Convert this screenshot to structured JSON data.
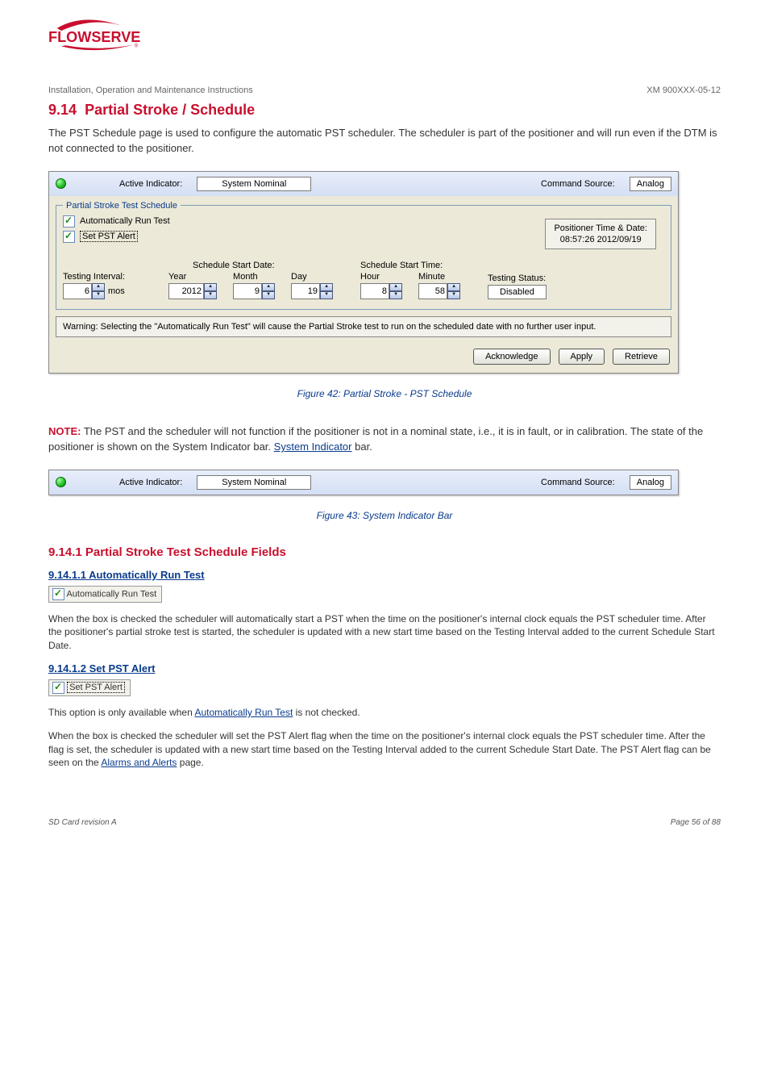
{
  "header": {
    "doc_type": "Installation, Operation and Maintenance Instructions",
    "doc_ref": "XM 900XXX-05-12"
  },
  "section": {
    "number": "9.14",
    "title": "Partial Stroke / Schedule",
    "intro": "The PST Schedule page is used to configure the automatic PST scheduler. The scheduler is part of the positioner and will run even if the DTM is not connected to the positioner.",
    "figure_caption": "Figure 42: Partial Stroke - PST Schedule"
  },
  "ui": {
    "active_indicator_label": "Active Indicator:",
    "active_indicator_value": "System Nominal",
    "command_source_label": "Command Source:",
    "command_source_value": "Analog",
    "group_title": "Partial Stroke Test Schedule",
    "auto_run_label": "Automatically Run Test",
    "set_pst_label": "Set PST Alert",
    "positioner_time_label": "Positioner Time & Date:",
    "positioner_time_value": "08:57:26 2012/09/19",
    "testing_interval_label": "Testing Interval:",
    "testing_interval_value": "6",
    "testing_interval_unit": "mos",
    "schedule_start_date_label": "Schedule Start Date:",
    "schedule_start_time_label": "Schedule Start Time:",
    "year_label": "Year",
    "year_value": "2012",
    "month_label": "Month",
    "month_value": "9",
    "day_label": "Day",
    "day_value": "19",
    "hour_label": "Hour",
    "hour_value": "8",
    "minute_label": "Minute",
    "minute_value": "58",
    "testing_status_label": "Testing Status:",
    "testing_status_value": "Disabled",
    "warning_text": "Warning: Selecting the \"Automatically Run Test\" will cause the Partial Stroke test to run on the scheduled date with no further user input.",
    "btn_acknowledge": "Acknowledge",
    "btn_apply": "Apply",
    "btn_retrieve": "Retrieve"
  },
  "notes": {
    "note_label": "NOTE:",
    "note_text": "The PST and the scheduler will not function if the positioner is not in a nominal state, i.e., it is in fault, or in calibration. The state of the positioner is shown on the System Indicator bar.",
    "note_figure_caption": "Figure 43: System Indicator Bar",
    "fields_heading": "9.14.1 Partial Stroke Test Schedule Fields",
    "auto_sub": "9.14.1.1 Automatically Run Test",
    "auto_text": "When the box is checked the scheduler will automatically start a PST when the time on the positioner's internal clock equals the PST scheduler time. After the positioner's partial stroke test is started, the scheduler is updated with a new start time based on the Testing Interval added to the current Schedule Start Date.",
    "pst_sub": "9.14.1.2 Set PST Alert",
    "pst_text_1": "This option is only available when ",
    "pst_link": "Automatically Run Test",
    "pst_text_2": " is not checked.",
    "pst_text_para2_a": "When the box is checked the scheduler will set the PST Alert flag when the time on the positioner's internal clock equals the PST scheduler time. After the flag is set, the scheduler is updated with a new start time based on the Testing Interval added to the current Schedule Start Date. The PST Alert flag can be seen on the ",
    "pst_text_para2_link": "Alarms and Alerts",
    "pst_text_para2_b": " page."
  },
  "footer": {
    "left": "SD Card revision A",
    "right": "Page 56 of 88"
  }
}
